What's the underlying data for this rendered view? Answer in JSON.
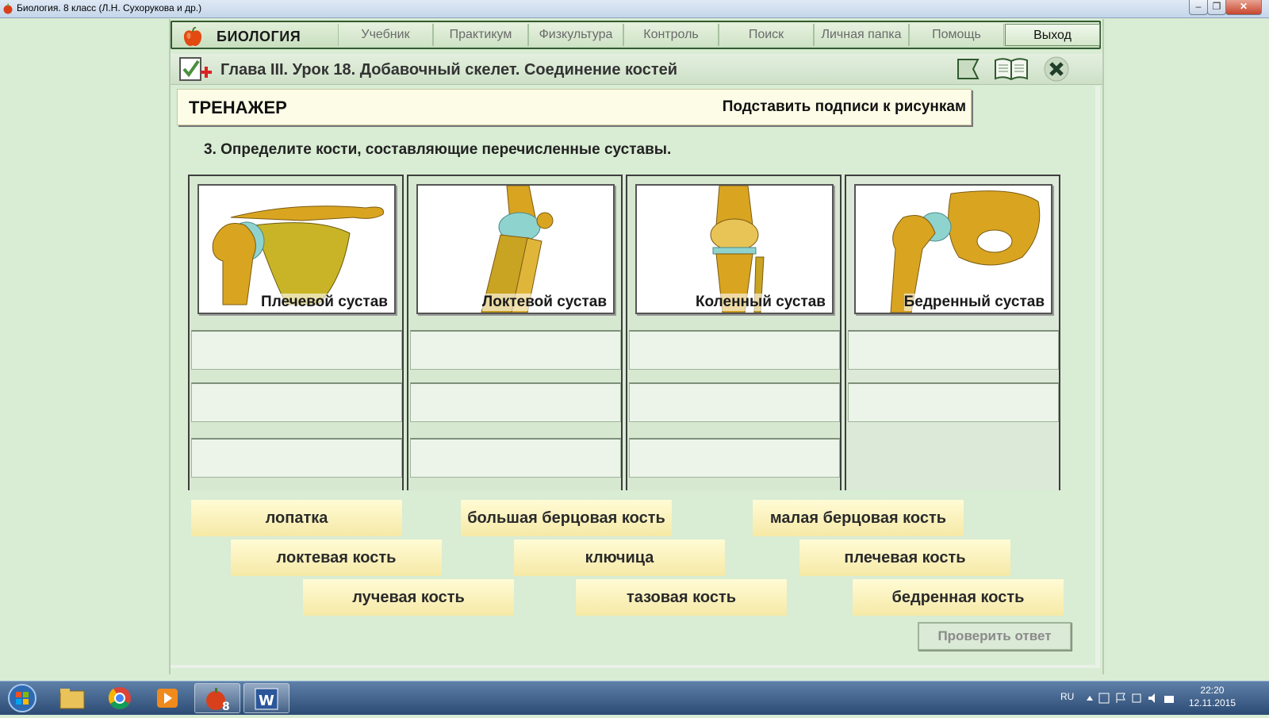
{
  "window": {
    "title": "Биология. 8 класс (Л.Н. Сухорукова и др.)",
    "minimize": "–",
    "restore": "❐",
    "close": "✕"
  },
  "nav": {
    "brand": "БИОЛОГИЯ",
    "items": [
      "Учебник",
      "Практикум",
      "Физкультура",
      "Контроль",
      "Поиск",
      "Личная папка",
      "Помощь"
    ],
    "exit": "Выход"
  },
  "lesson": {
    "title": "Глава III. Урок 18. Добавочный скелет. Соединение костей"
  },
  "trainer": {
    "title": "ТРЕНАЖЕР",
    "task_type": "Подставить подписи к рисункам"
  },
  "question": "3. Определите кости, составляющие перечисленные суставы.",
  "joints": [
    {
      "caption": "Плечевой сустав",
      "slots": 3
    },
    {
      "caption": "Локтевой сустав",
      "slots": 3
    },
    {
      "caption": "Коленный сустав",
      "slots": 3
    },
    {
      "caption": "Бедренный сустав",
      "slots": 2
    }
  ],
  "chips": [
    "лопатка",
    "большая берцовая кость",
    "малая берцовая кость",
    "локтевая кость",
    "ключица",
    "плечевая кость",
    "лучевая кость",
    "тазовая кость",
    "бедренная кость"
  ],
  "check_button": "Проверить ответ",
  "taskbar": {
    "language": "RU",
    "time": "22:20",
    "date": "12.11.2015"
  },
  "colors": {
    "background": "#d9ecd4",
    "nav_border": "#315a30",
    "chip": "#f6e9a6",
    "cartilage": "#8fd3cf",
    "bone": "#d9a521"
  }
}
